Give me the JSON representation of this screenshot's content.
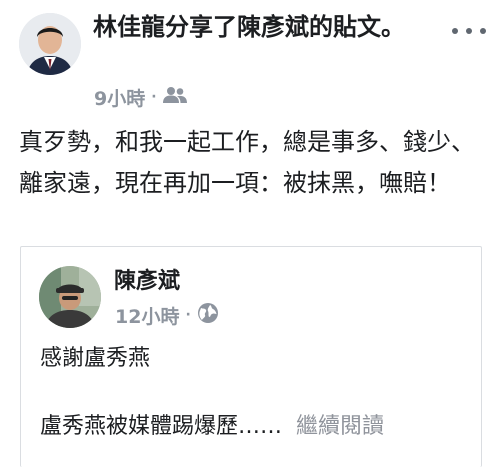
{
  "post": {
    "header_text": "林佳龍分享了陳彥斌的貼文。",
    "timestamp": "9小時",
    "separator": "·",
    "audience_icon": "friends-icon",
    "more_icon": "more-options-icon",
    "body": "真歹勢，和我一起工作，總是事多、錢少、離家遠，現在再加一項：被抹黑，嘸賠！"
  },
  "shared_post": {
    "author": "陳彥斌",
    "timestamp": "12小時",
    "separator": "·",
    "audience_icon": "globe-icon",
    "line1": "感謝盧秀燕",
    "line2": "盧秀燕被媒體踢爆歷……",
    "see_more": "繼續閱讀"
  },
  "colors": {
    "text": "#1c1e21",
    "meta": "#8d949e",
    "link_gray": "#90949c",
    "border": "#dadde1"
  }
}
